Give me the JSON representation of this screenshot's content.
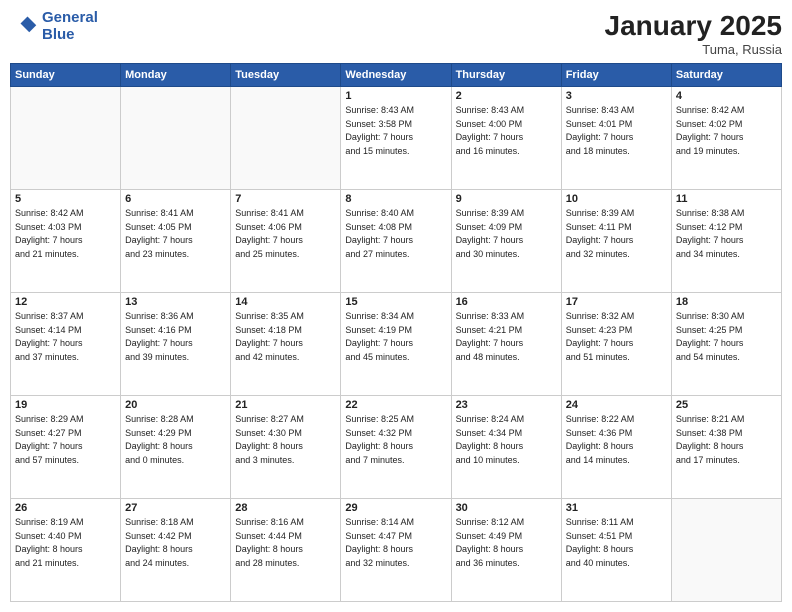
{
  "header": {
    "logo_line1": "General",
    "logo_line2": "Blue",
    "title": "January 2025",
    "location": "Tuma, Russia"
  },
  "days_of_week": [
    "Sunday",
    "Monday",
    "Tuesday",
    "Wednesday",
    "Thursday",
    "Friday",
    "Saturday"
  ],
  "weeks": [
    [
      {
        "day": "",
        "info": ""
      },
      {
        "day": "",
        "info": ""
      },
      {
        "day": "",
        "info": ""
      },
      {
        "day": "1",
        "info": "Sunrise: 8:43 AM\nSunset: 3:58 PM\nDaylight: 7 hours\nand 15 minutes."
      },
      {
        "day": "2",
        "info": "Sunrise: 8:43 AM\nSunset: 4:00 PM\nDaylight: 7 hours\nand 16 minutes."
      },
      {
        "day": "3",
        "info": "Sunrise: 8:43 AM\nSunset: 4:01 PM\nDaylight: 7 hours\nand 18 minutes."
      },
      {
        "day": "4",
        "info": "Sunrise: 8:42 AM\nSunset: 4:02 PM\nDaylight: 7 hours\nand 19 minutes."
      }
    ],
    [
      {
        "day": "5",
        "info": "Sunrise: 8:42 AM\nSunset: 4:03 PM\nDaylight: 7 hours\nand 21 minutes."
      },
      {
        "day": "6",
        "info": "Sunrise: 8:41 AM\nSunset: 4:05 PM\nDaylight: 7 hours\nand 23 minutes."
      },
      {
        "day": "7",
        "info": "Sunrise: 8:41 AM\nSunset: 4:06 PM\nDaylight: 7 hours\nand 25 minutes."
      },
      {
        "day": "8",
        "info": "Sunrise: 8:40 AM\nSunset: 4:08 PM\nDaylight: 7 hours\nand 27 minutes."
      },
      {
        "day": "9",
        "info": "Sunrise: 8:39 AM\nSunset: 4:09 PM\nDaylight: 7 hours\nand 30 minutes."
      },
      {
        "day": "10",
        "info": "Sunrise: 8:39 AM\nSunset: 4:11 PM\nDaylight: 7 hours\nand 32 minutes."
      },
      {
        "day": "11",
        "info": "Sunrise: 8:38 AM\nSunset: 4:12 PM\nDaylight: 7 hours\nand 34 minutes."
      }
    ],
    [
      {
        "day": "12",
        "info": "Sunrise: 8:37 AM\nSunset: 4:14 PM\nDaylight: 7 hours\nand 37 minutes."
      },
      {
        "day": "13",
        "info": "Sunrise: 8:36 AM\nSunset: 4:16 PM\nDaylight: 7 hours\nand 39 minutes."
      },
      {
        "day": "14",
        "info": "Sunrise: 8:35 AM\nSunset: 4:18 PM\nDaylight: 7 hours\nand 42 minutes."
      },
      {
        "day": "15",
        "info": "Sunrise: 8:34 AM\nSunset: 4:19 PM\nDaylight: 7 hours\nand 45 minutes."
      },
      {
        "day": "16",
        "info": "Sunrise: 8:33 AM\nSunset: 4:21 PM\nDaylight: 7 hours\nand 48 minutes."
      },
      {
        "day": "17",
        "info": "Sunrise: 8:32 AM\nSunset: 4:23 PM\nDaylight: 7 hours\nand 51 minutes."
      },
      {
        "day": "18",
        "info": "Sunrise: 8:30 AM\nSunset: 4:25 PM\nDaylight: 7 hours\nand 54 minutes."
      }
    ],
    [
      {
        "day": "19",
        "info": "Sunrise: 8:29 AM\nSunset: 4:27 PM\nDaylight: 7 hours\nand 57 minutes."
      },
      {
        "day": "20",
        "info": "Sunrise: 8:28 AM\nSunset: 4:29 PM\nDaylight: 8 hours\nand 0 minutes."
      },
      {
        "day": "21",
        "info": "Sunrise: 8:27 AM\nSunset: 4:30 PM\nDaylight: 8 hours\nand 3 minutes."
      },
      {
        "day": "22",
        "info": "Sunrise: 8:25 AM\nSunset: 4:32 PM\nDaylight: 8 hours\nand 7 minutes."
      },
      {
        "day": "23",
        "info": "Sunrise: 8:24 AM\nSunset: 4:34 PM\nDaylight: 8 hours\nand 10 minutes."
      },
      {
        "day": "24",
        "info": "Sunrise: 8:22 AM\nSunset: 4:36 PM\nDaylight: 8 hours\nand 14 minutes."
      },
      {
        "day": "25",
        "info": "Sunrise: 8:21 AM\nSunset: 4:38 PM\nDaylight: 8 hours\nand 17 minutes."
      }
    ],
    [
      {
        "day": "26",
        "info": "Sunrise: 8:19 AM\nSunset: 4:40 PM\nDaylight: 8 hours\nand 21 minutes."
      },
      {
        "day": "27",
        "info": "Sunrise: 8:18 AM\nSunset: 4:42 PM\nDaylight: 8 hours\nand 24 minutes."
      },
      {
        "day": "28",
        "info": "Sunrise: 8:16 AM\nSunset: 4:44 PM\nDaylight: 8 hours\nand 28 minutes."
      },
      {
        "day": "29",
        "info": "Sunrise: 8:14 AM\nSunset: 4:47 PM\nDaylight: 8 hours\nand 32 minutes."
      },
      {
        "day": "30",
        "info": "Sunrise: 8:12 AM\nSunset: 4:49 PM\nDaylight: 8 hours\nand 36 minutes."
      },
      {
        "day": "31",
        "info": "Sunrise: 8:11 AM\nSunset: 4:51 PM\nDaylight: 8 hours\nand 40 minutes."
      },
      {
        "day": "",
        "info": ""
      }
    ]
  ]
}
